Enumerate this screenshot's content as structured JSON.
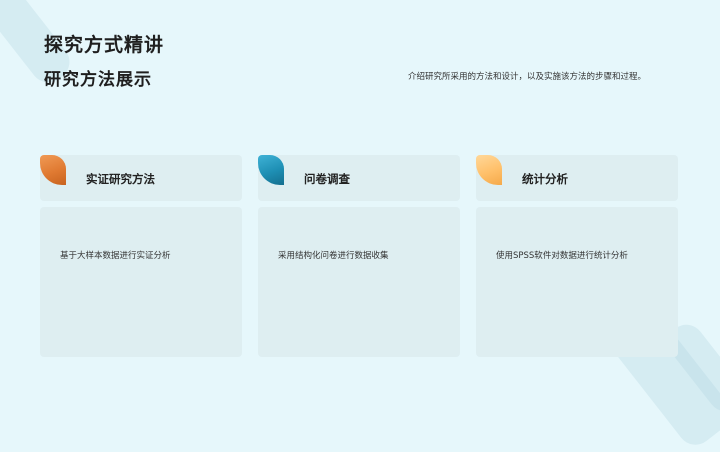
{
  "header": {
    "title": "探究方式精讲",
    "subtitle": "研究方法展示",
    "description": "介绍研究所采用的方法和设计，以及实施该方法的步骤和过程。"
  },
  "cards": [
    {
      "label": "实证研究方法",
      "text": "基于大样本数据进行实证分析",
      "accent": "#e07a32"
    },
    {
      "label": "问卷调查",
      "text": "采用结构化问卷进行数据收集",
      "accent": "#1e8fb4"
    },
    {
      "label": "统计分析",
      "text": "使用SPSS软件对数据进行统计分析",
      "accent": "#ffc06a"
    }
  ]
}
